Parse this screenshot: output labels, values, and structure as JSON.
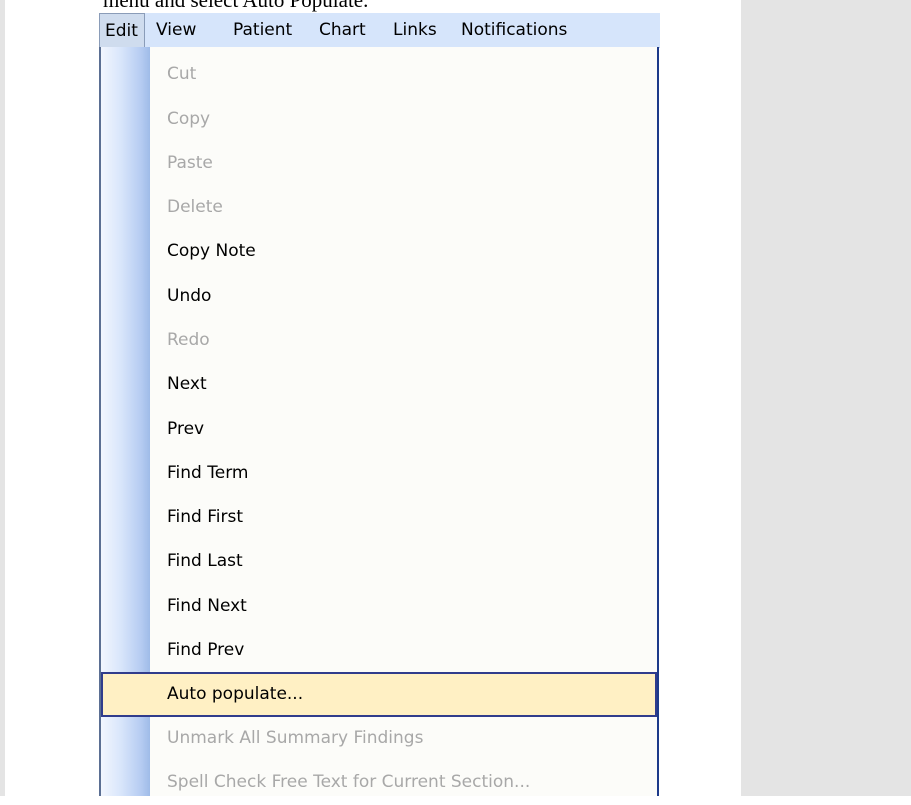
{
  "caption": "menu and select Auto Populate.",
  "menubar": {
    "items": [
      {
        "label": "Edit"
      },
      {
        "label": "View"
      },
      {
        "label": "Patient"
      },
      {
        "label": "Chart"
      },
      {
        "label": "Links"
      },
      {
        "label": "Notifications"
      }
    ]
  },
  "menu": {
    "items": [
      {
        "label": "Cut",
        "enabled": false
      },
      {
        "label": "Copy",
        "enabled": false
      },
      {
        "label": "Paste",
        "enabled": false
      },
      {
        "label": "Delete",
        "enabled": false
      },
      {
        "label": "Copy Note",
        "enabled": true
      },
      {
        "label": "Undo",
        "enabled": true
      },
      {
        "label": "Redo",
        "enabled": false
      },
      {
        "label": "Next",
        "enabled": true
      },
      {
        "label": "Prev",
        "enabled": true
      },
      {
        "label": "Find Term",
        "enabled": true
      },
      {
        "label": "Find First",
        "enabled": true
      },
      {
        "label": "Find Last",
        "enabled": true
      },
      {
        "label": "Find Next",
        "enabled": true
      },
      {
        "label": "Find Prev",
        "enabled": true
      },
      {
        "label": "Auto populate...",
        "enabled": true,
        "highlighted": true
      },
      {
        "label": "Unmark All Summary Findings",
        "enabled": false
      },
      {
        "label": "Spell Check Free Text for Current Section...",
        "enabled": false
      }
    ]
  },
  "colors": {
    "highlight_bg": "#fff0c4",
    "highlight_border": "#303c8c",
    "disabled_text": "#a8a8a8",
    "menubar_bg": "#d6e5fb"
  }
}
